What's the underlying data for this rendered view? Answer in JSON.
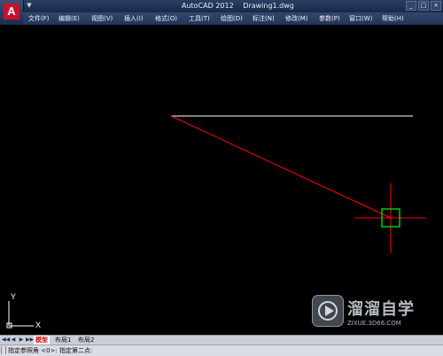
{
  "title_bar": {
    "app_name": "AutoCAD 2012",
    "file_name": "Drawing1.dwg",
    "app_logo_letter": "A",
    "qa_arrow": "▼",
    "controls": [
      "_",
      "□",
      "×"
    ]
  },
  "menu": [
    "文件(F)",
    "编辑(E)",
    "视图(V)",
    "插入(I)",
    "格式(O)",
    "工具(T)",
    "绘图(D)",
    "标注(N)",
    "修改(M)",
    "参数(P)",
    "窗口(W)",
    "帮助(H)"
  ],
  "canvas": {
    "background": "#000000",
    "ucs": {
      "y_label": "Y",
      "x_label": "X"
    },
    "colors": {
      "existing_line": "#ffffff",
      "rubber_band": "#ff0000",
      "crosshair": "#ff0000",
      "pickbox": "#00cc00"
    }
  },
  "layout_tabs": {
    "nav": [
      "◀◀",
      "◀",
      "▶",
      "▶▶"
    ],
    "tabs": [
      "模型",
      "布局1",
      "布局2"
    ],
    "active": "模型"
  },
  "command_line": {
    "prompt": "指定参照角 <0>:  指定第二点:"
  },
  "watermark": {
    "text": "溜溜自学",
    "url": "ZIXUE.3D66.COM"
  }
}
